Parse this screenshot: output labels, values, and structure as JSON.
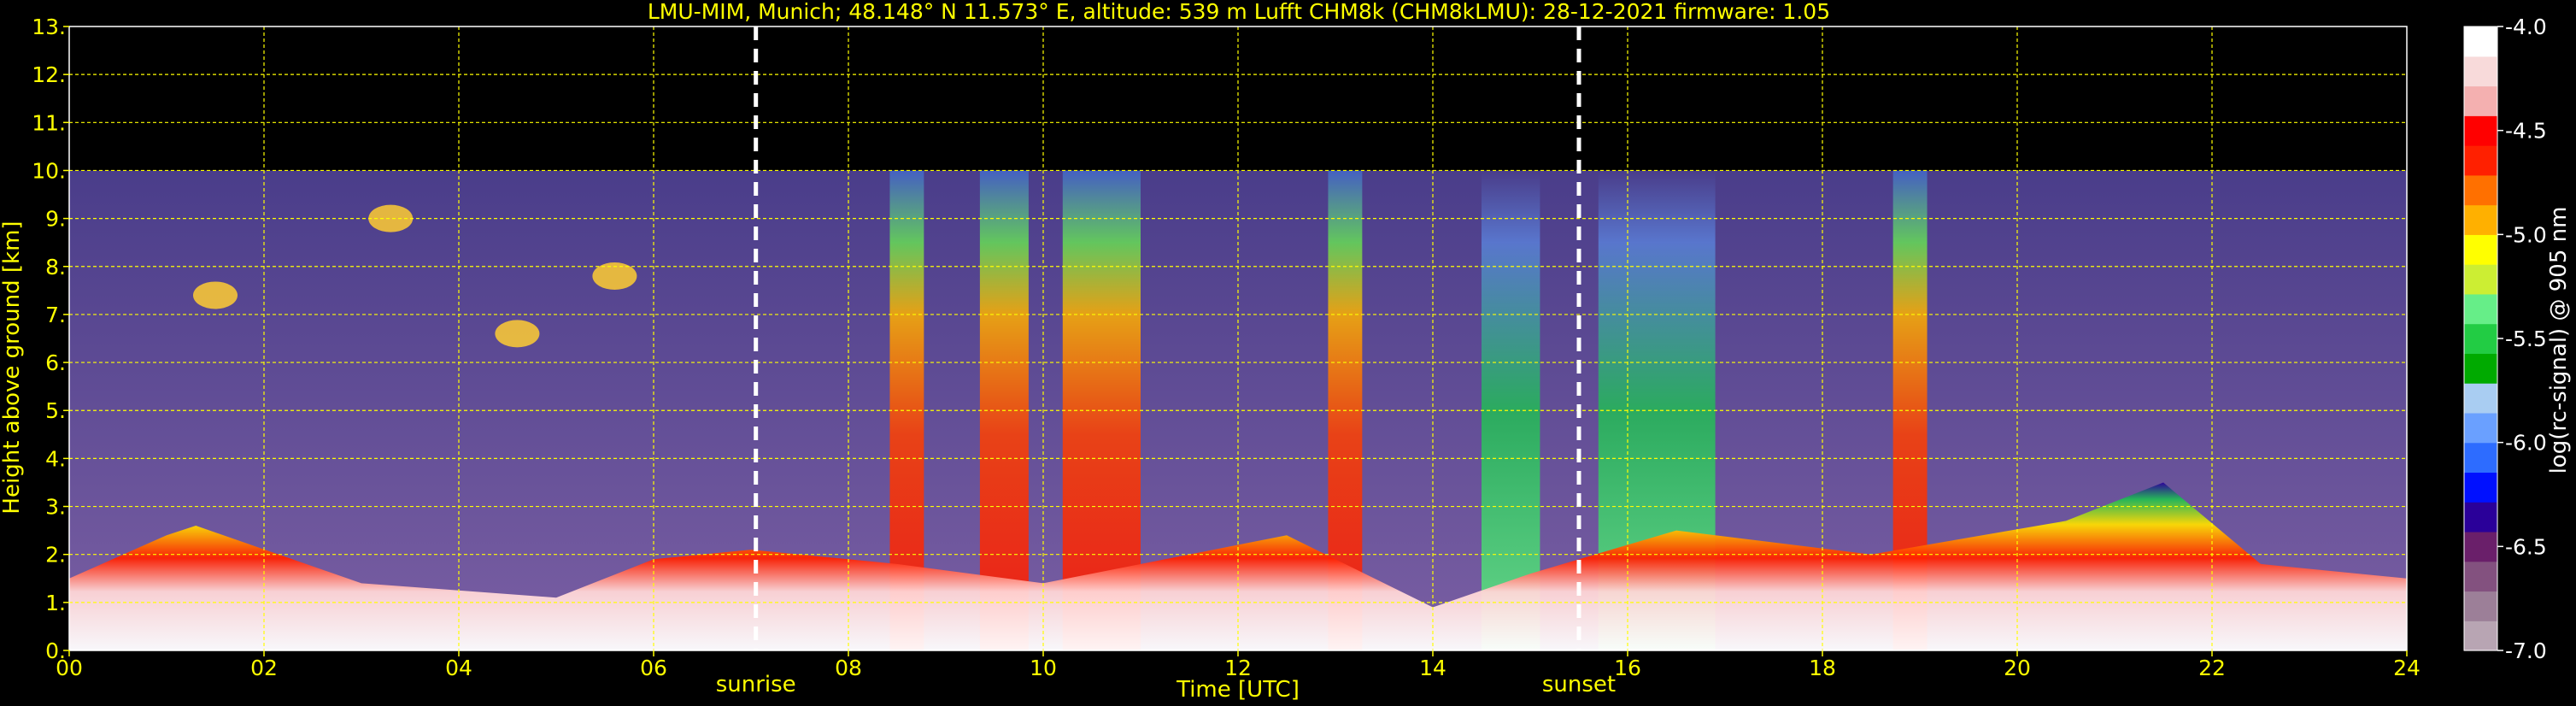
{
  "chart_data": {
    "type": "heatmap",
    "title": "LMU-MIM, Munich; 48.148° N 11.573° E, altitude: 539 m    Lufft CHM8k (CHM8kLMU): 28-12-2021    firmware: 1.05",
    "xlabel": "Time [UTC]",
    "ylabel": "Height above ground [km]",
    "xlim": [
      0,
      24
    ],
    "ylim": [
      0,
      13
    ],
    "data_top_km": 10,
    "x_ticks": [
      "00",
      "02",
      "04",
      "06",
      "08",
      "10",
      "12",
      "14",
      "16",
      "18",
      "20",
      "22",
      "24"
    ],
    "y_ticks": [
      "0.",
      "1.",
      "2.",
      "3.",
      "4.",
      "5.",
      "6.",
      "7.",
      "8.",
      "9.",
      "10.",
      "11.",
      "12.",
      "13."
    ],
    "grid": true,
    "grid_color": "#ffff00",
    "text_color": "#ffff00",
    "background": "#000000",
    "markers": [
      {
        "label": "sunrise",
        "time_h": 7.05
      },
      {
        "label": "sunset",
        "time_h": 15.5
      }
    ],
    "colorbar": {
      "label": "log(rc-signal) @ 905 nm",
      "range": [
        -7.0,
        -4.0
      ],
      "ticks": [
        "-4.0",
        "-4.5",
        "-5.0",
        "-5.5",
        "-6.0",
        "-6.5",
        "-7.0"
      ],
      "colors": [
        "#b8a5b3",
        "#9c7f98",
        "#83517f",
        "#6a1f6a",
        "#2a0099",
        "#0010ff",
        "#2d6cff",
        "#6aa0ff",
        "#a9cdf2",
        "#00aa00",
        "#22cc44",
        "#66ee88",
        "#ccee33",
        "#ffff00",
        "#ffb000",
        "#ff7000",
        "#ff2000",
        "#ff0000",
        "#f4b0b0",
        "#f8dada",
        "#ffffff"
      ]
    },
    "features": {
      "boundary_layer": [
        {
          "t": 0.0,
          "top_km": 1.5
        },
        {
          "t": 1.0,
          "top_km": 2.4
        },
        {
          "t": 1.3,
          "top_km": 2.6
        },
        {
          "t": 3.0,
          "top_km": 1.4
        },
        {
          "t": 5.0,
          "top_km": 1.1
        },
        {
          "t": 6.0,
          "top_km": 1.9
        },
        {
          "t": 7.0,
          "top_km": 2.1
        },
        {
          "t": 8.5,
          "top_km": 1.8
        },
        {
          "t": 10.0,
          "top_km": 1.4
        },
        {
          "t": 12.5,
          "top_km": 2.4
        },
        {
          "t": 14.0,
          "top_km": 0.9
        },
        {
          "t": 15.0,
          "top_km": 1.6
        },
        {
          "t": 16.5,
          "top_km": 2.5
        },
        {
          "t": 18.5,
          "top_km": 2.0
        },
        {
          "t": 20.5,
          "top_km": 2.7
        },
        {
          "t": 21.5,
          "top_km": 3.5
        },
        {
          "t": 22.5,
          "top_km": 1.8
        },
        {
          "t": 24.0,
          "top_km": 1.5
        }
      ],
      "precipitation_bands": [
        {
          "t": 8.6,
          "width_h": 0.35,
          "level": "high"
        },
        {
          "t": 9.6,
          "width_h": 0.5,
          "level": "high"
        },
        {
          "t": 10.6,
          "width_h": 0.8,
          "level": "high"
        },
        {
          "t": 13.1,
          "width_h": 0.35,
          "level": "high"
        },
        {
          "t": 14.8,
          "width_h": 0.6,
          "level": "medium"
        },
        {
          "t": 16.3,
          "width_h": 1.2,
          "level": "medium"
        },
        {
          "t": 18.9,
          "width_h": 0.35,
          "level": "high"
        }
      ],
      "cirrus_clouds": [
        {
          "t": 1.5,
          "height_km": 7.4
        },
        {
          "t": 3.3,
          "height_km": 9.0
        },
        {
          "t": 4.6,
          "height_km": 6.6
        },
        {
          "t": 5.6,
          "height_km": 7.8
        }
      ]
    }
  }
}
